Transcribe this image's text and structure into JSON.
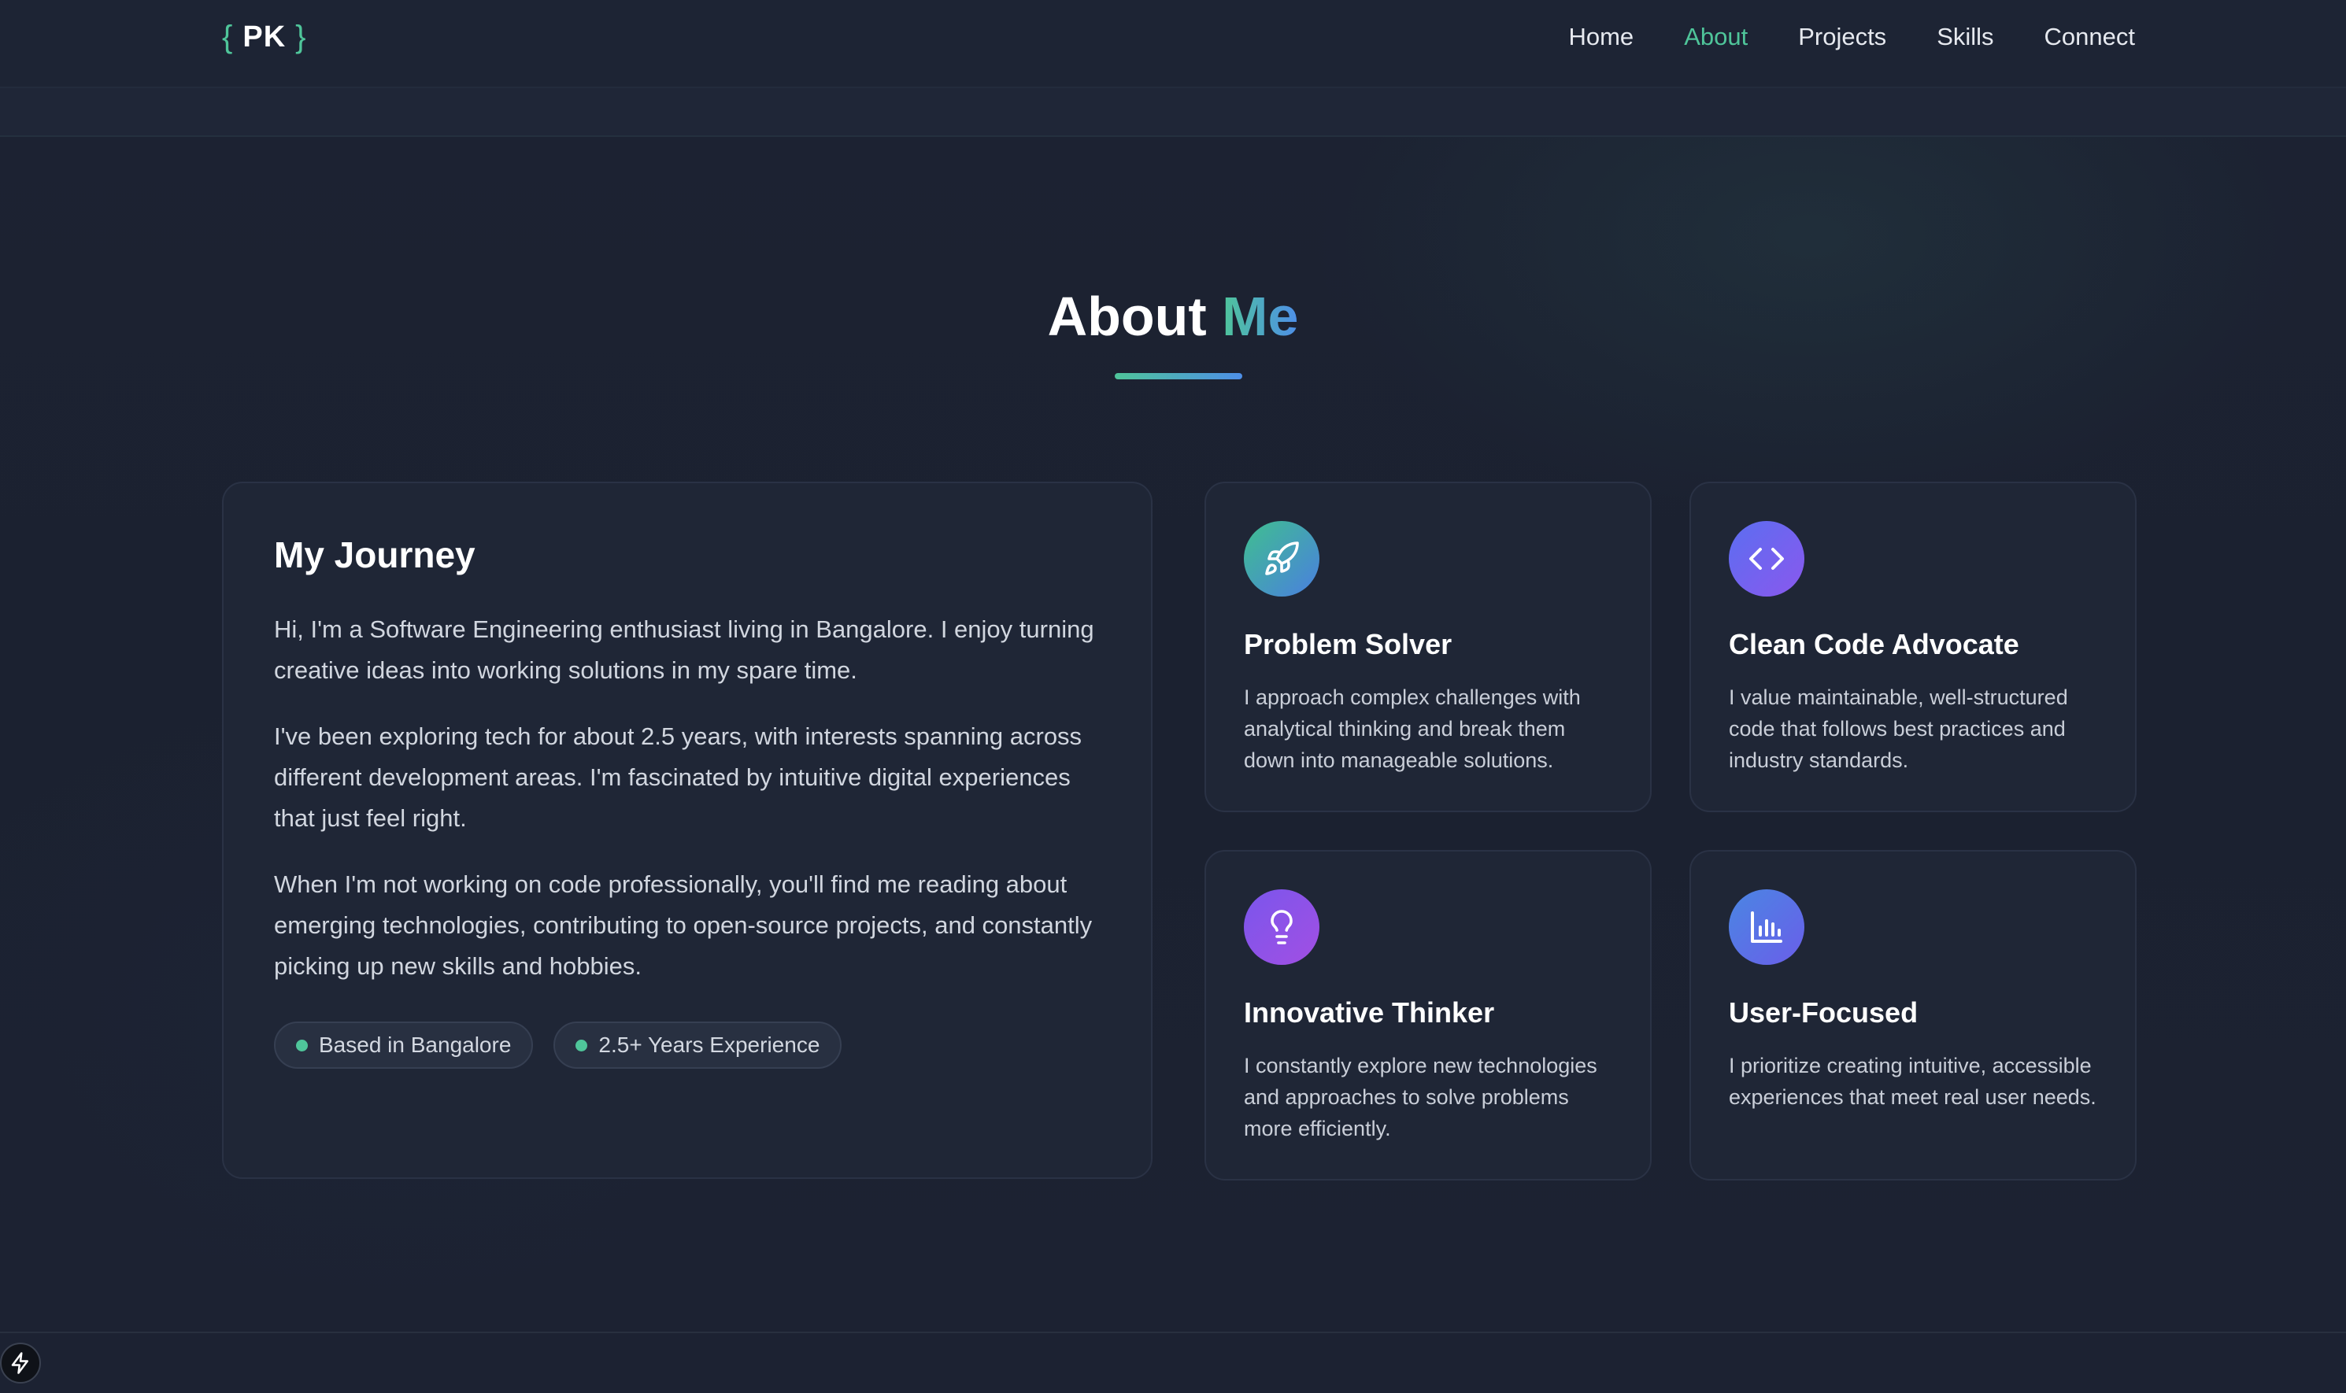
{
  "header": {
    "logo_open": "{",
    "logo_text": "PK",
    "logo_close": "}",
    "nav": [
      {
        "label": "Home"
      },
      {
        "label": "About"
      },
      {
        "label": "Projects"
      },
      {
        "label": "Skills"
      },
      {
        "label": "Connect"
      }
    ],
    "active_nav": "About"
  },
  "section": {
    "title_main": "About",
    "title_accent": "Me"
  },
  "journey": {
    "heading": "My Journey",
    "paragraphs": [
      "Hi, I'm a Software Engineering enthusiast living in Bangalore. I enjoy turning creative ideas into working solutions in my spare time.",
      "I've been exploring tech for about 2.5 years, with interests spanning across different development areas. I'm fascinated by intuitive digital experiences that just feel right.",
      "When I'm not working on code professionally, you'll find me reading about emerging technologies, contributing to open-source projects, and constantly picking up new skills and hobbies."
    ],
    "badges": [
      {
        "label": "Based in Bangalore"
      },
      {
        "label": "2.5+ Years Experience"
      }
    ]
  },
  "features": [
    {
      "icon": "rocket-icon",
      "title": "Problem Solver",
      "text": "I approach complex challenges with analytical thinking and break them down into manageable solutions."
    },
    {
      "icon": "code-icon",
      "title": "Clean Code Advocate",
      "text": "I value maintainable, well-structured code that follows best practices and industry standards."
    },
    {
      "icon": "lightbulb-icon",
      "title": "Innovative Thinker",
      "text": "I constantly explore new technologies and approaches to solve problems more efficiently."
    },
    {
      "icon": "bar-chart-icon",
      "title": "User-Focused",
      "text": "I prioritize creating intuitive, accessible experiences that meet real user needs."
    }
  ],
  "colors": {
    "accent_green": "#4fc59a",
    "accent_blue": "#4e8fe8",
    "background": "#1b2131",
    "card": "#1f2636"
  }
}
